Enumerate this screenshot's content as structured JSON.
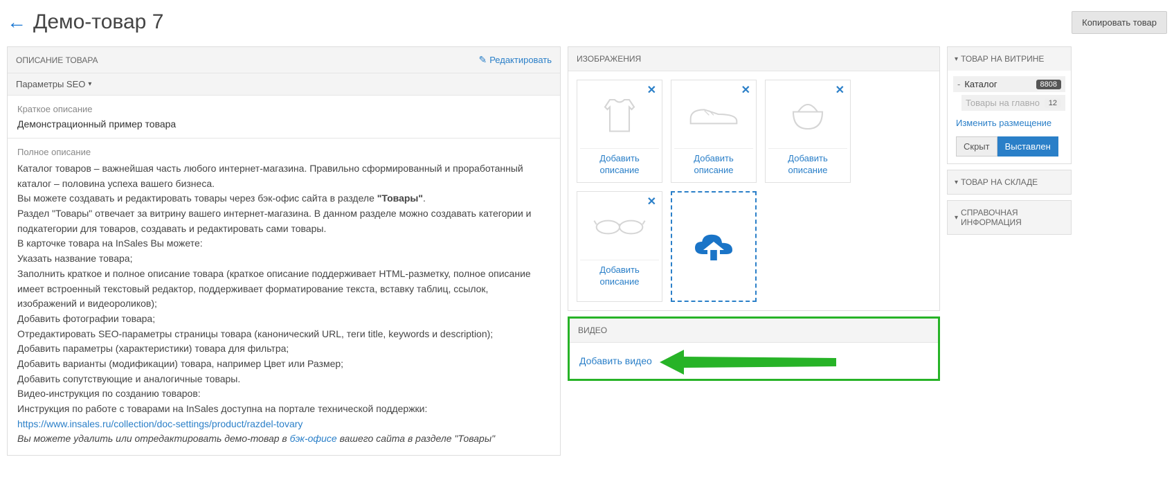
{
  "header": {
    "title": "Демо-товар 7",
    "copy_button": "Копировать товар"
  },
  "desc_panel": {
    "title": "ОПИСАНИЕ ТОВАРА",
    "edit_label": "Редактировать",
    "seo_dropdown": "Параметры SEO",
    "short_label": "Краткое описание",
    "short_value": "Демонстрационный пример товара",
    "full_label": "Полное описание",
    "full_p1a": "Каталог товаров – важнейшая часть любого интернет-магазина. Правильно сформированный и проработанный каталог – половина успеха вашего бизнеса.",
    "full_p1b_before": "Вы можете создавать и редактировать товары через бэк-офис сайта в разделе ",
    "full_p1b_strong": "\"Товары\"",
    "full_p1b_after": ".",
    "full_p1c": "Раздел \"Товары\" отвечает за витрину вашего интернет-магазина. В данном разделе можно создавать категории и подкатегории для товаров, создавать и редактировать сами товары.",
    "full_list_intro": "В карточке товара на InSales Вы можете:",
    "full_li1": "Указать название товара;",
    "full_li2": "Заполнить краткое и полное описание товара (краткое описание поддерживает HTML-разметку, полное описание имеет встроенный текстовый редактор, поддерживает форматирование текста, вставку таблиц, ссылок, изображений и видеороликов);",
    "full_li3": "Добавить фотографии товара;",
    "full_li4": "Отредактировать SEO-параметры страницы товара (канонический URL, теги title, keywords и description);",
    "full_li5": "Добавить параметры (характеристики) товара для фильтра;",
    "full_li6": "Добавить варианты (модификации) товара, например Цвет или Размер;",
    "full_li7": "Добавить сопутствующие и аналогичные товары.",
    "video_instr": "Видео-инструкция по созданию товаров:",
    "support_before": "Инструкция по работе с товарами на InSales доступна на портале технической поддержки: ",
    "support_link": "https://www.insales.ru/collection/doc-settings/product/razdel-tovary",
    "em_before": "Вы можете удалить или отредактировать демо-товар в ",
    "em_link": "бэк-офисе",
    "em_after": " вашего сайта в разделе \"Товары\""
  },
  "images_panel": {
    "title": "ИЗОБРАЖЕНИЯ",
    "add_desc_top": "Добавить",
    "add_desc_bottom": "описание"
  },
  "video_panel": {
    "title": "ВИДЕО",
    "add_video": "Добавить видео"
  },
  "right": {
    "showcase_title": "ТОВАР НА ВИТРИНЕ",
    "cat_name": "Каталог",
    "cat_badge": "8808",
    "subcat_name": "Товары на главно",
    "subcat_badge": "12",
    "change_placement": "Изменить размещение",
    "hide_btn": "Скрыт",
    "shown_btn": "Выставлен",
    "stock_title": "ТОВАР НА СКЛАДЕ",
    "ref_title": "СПРАВОЧНАЯ ИНФОРМАЦИЯ"
  }
}
